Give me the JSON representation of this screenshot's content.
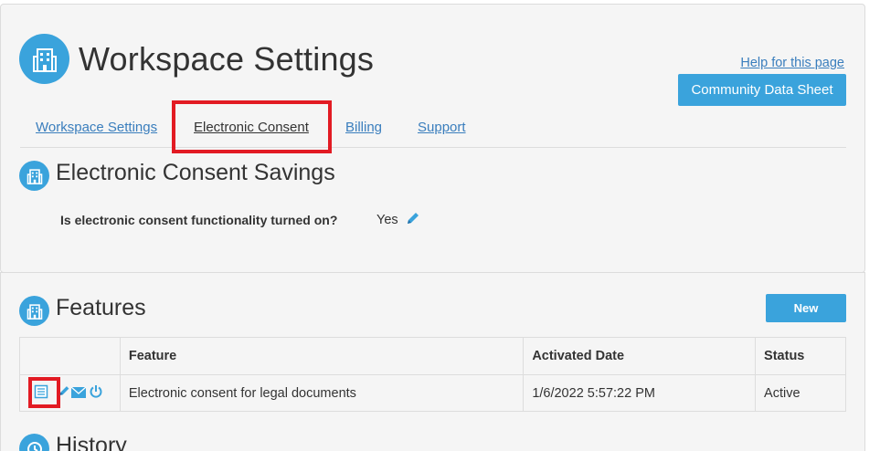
{
  "header": {
    "page_title": "Workspace Settings",
    "help_link": "Help for this page",
    "community_button": "Community Data Sheet"
  },
  "tabs": [
    {
      "label": "Workspace Settings",
      "active": false
    },
    {
      "label": "Electronic Consent",
      "active": true
    },
    {
      "label": "Billing",
      "active": false
    },
    {
      "label": "Support",
      "active": false
    }
  ],
  "consent_section": {
    "title": "Electronic Consent Savings",
    "setting_label": "Is electronic consent functionality turned on?",
    "setting_value": "Yes"
  },
  "features_section": {
    "title": "Features",
    "new_button": "New",
    "columns": [
      "",
      "Feature",
      "Activated Date",
      "Status"
    ],
    "rows": [
      {
        "feature": "Electronic consent for legal documents",
        "activated_date": "1/6/2022 5:57:22 PM",
        "status": "Active"
      }
    ]
  },
  "history_section": {
    "title": "History"
  },
  "colors": {
    "accent": "#3aa3dc",
    "link": "#3a7ebd",
    "highlight": "#e21b23"
  },
  "icons": [
    "building-icon",
    "edit-icon",
    "details-icon",
    "email-icon",
    "power-icon",
    "history-icon"
  ]
}
